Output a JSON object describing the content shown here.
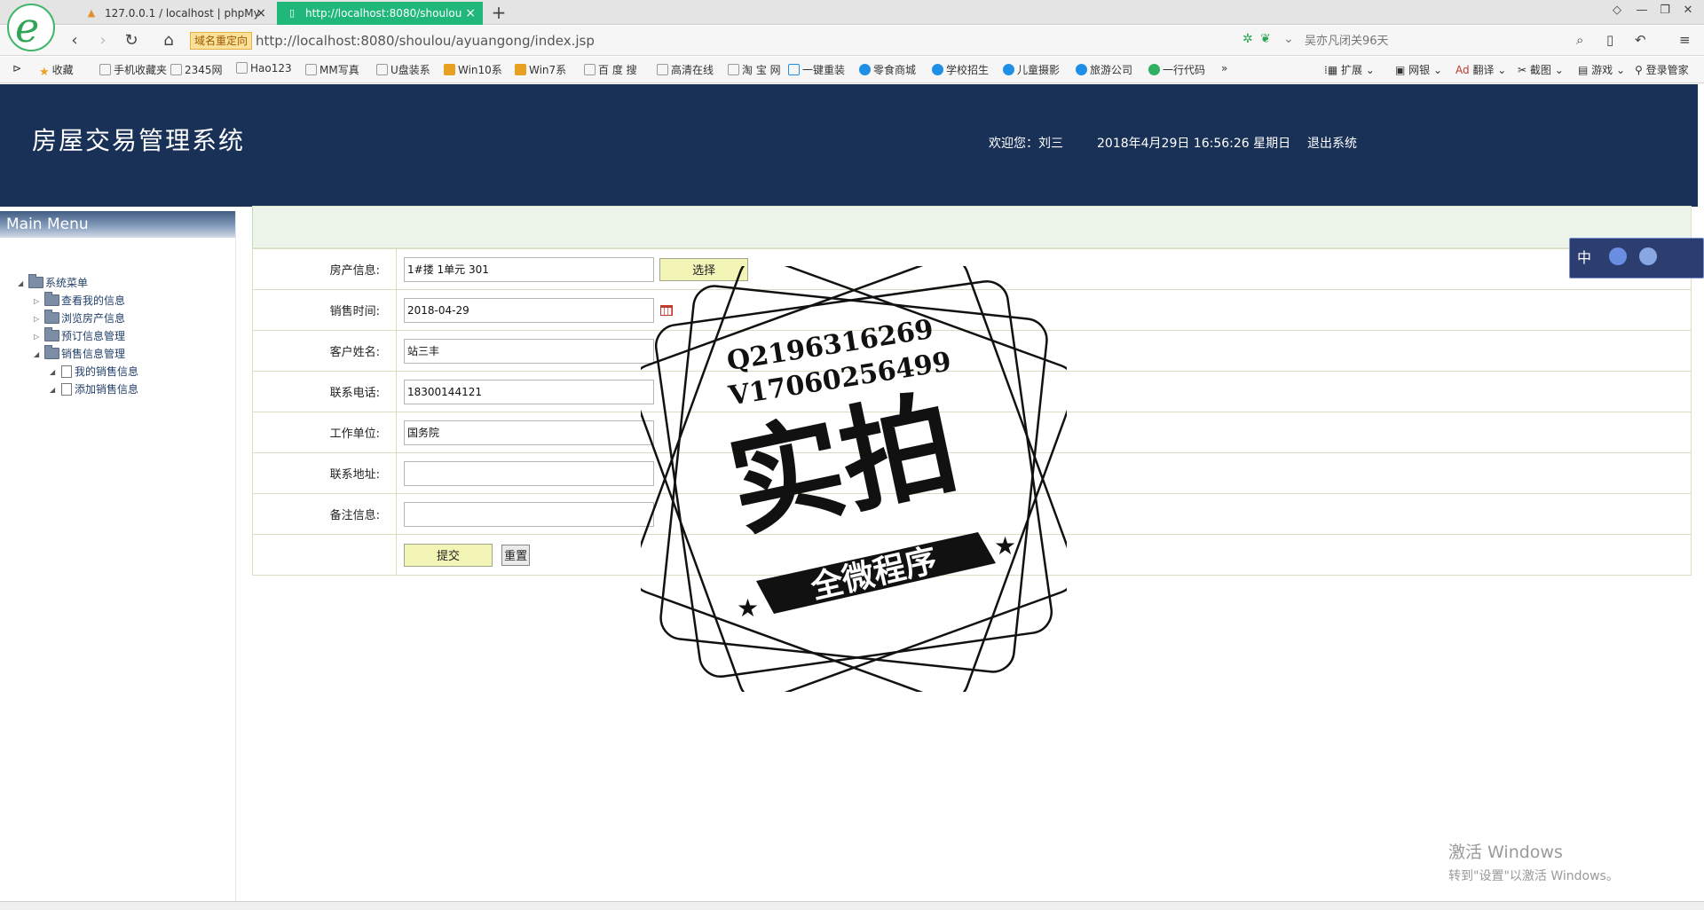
{
  "browser": {
    "tabs": [
      {
        "label": "127.0.0.1 / localhost | phpMy",
        "icon": "phpmyadmin-icon",
        "close": "×"
      },
      {
        "label": "http://localhost:8080/shoulou",
        "icon": "page-icon",
        "close": "×"
      }
    ],
    "new_tab": "+",
    "redirect_badge": "域名重定向",
    "url": "http://localhost:8080/shoulou/ayuangong/index.jsp",
    "search_placeholder": "吴亦凡闭关96天",
    "logo": "e"
  },
  "bookmarks": [
    {
      "label": "收藏",
      "icon": "star"
    },
    {
      "label": "手机收藏夹",
      "icon": "doc"
    },
    {
      "label": "2345网",
      "icon": "doc"
    },
    {
      "label": "Hao123",
      "icon": "doc"
    },
    {
      "label": "MM写真",
      "icon": "doc"
    },
    {
      "label": "U盘装系",
      "icon": "doc"
    },
    {
      "label": "Win10系",
      "icon": "win"
    },
    {
      "label": "Win7系",
      "icon": "win"
    },
    {
      "label": "百 度 搜",
      "icon": "doc"
    },
    {
      "label": "高清在线",
      "icon": "doc"
    },
    {
      "label": "淘 宝 网",
      "icon": "doc"
    },
    {
      "label": "一键重装",
      "icon": "doc"
    },
    {
      "label": "零食商城",
      "icon": "m"
    },
    {
      "label": "学校招生",
      "icon": "m"
    },
    {
      "label": "儿童摄影",
      "icon": "m"
    },
    {
      "label": "旅游公司",
      "icon": "m"
    },
    {
      "label": "一行代码",
      "icon": "g"
    }
  ],
  "bookmarks_more": "»",
  "toolbar_right": [
    {
      "label": "扩展"
    },
    {
      "label": "网银"
    },
    {
      "label": "翻译"
    },
    {
      "label": "截图"
    },
    {
      "label": "游戏"
    },
    {
      "label": "登录管家"
    }
  ],
  "header": {
    "title": "房屋交易管理系统",
    "welcome": "欢迎您：刘三",
    "datetime": "2018年4月29日 16:56:26 星期日",
    "logout": "退出系统"
  },
  "sidebar": {
    "title": "Main Menu",
    "root": "系统菜单",
    "items": [
      {
        "label": "查看我的信息"
      },
      {
        "label": "浏览房产信息"
      },
      {
        "label": "预订信息管理"
      },
      {
        "label": "销售信息管理"
      }
    ],
    "subitems": [
      {
        "label": "我的销售信息"
      },
      {
        "label": "添加销售信息"
      }
    ]
  },
  "form": {
    "property": {
      "label": "房产信息:",
      "value": "1#搂 1单元 301",
      "button": "选择"
    },
    "sale_date": {
      "label": "销售时间:",
      "value": "2018-04-29"
    },
    "customer_name": {
      "label": "客户姓名:",
      "value": "站三丰"
    },
    "phone": {
      "label": "联系电话:",
      "value": "18300144121"
    },
    "work_unit": {
      "label": "工作单位:",
      "value": "国务院"
    },
    "address": {
      "label": "联系地址:",
      "value": ""
    },
    "remarks": {
      "label": "备注信息:",
      "value": ""
    },
    "submit": "提交",
    "reset": "重置"
  },
  "stamp": {
    "line1": "Q2196316269",
    "line2": "V17060256499",
    "main": "实拍",
    "banner": "全微程序"
  },
  "float_widget": {
    "label": "中"
  },
  "windows_activation": {
    "line1": "激活 Windows",
    "line2": "转到\"设置\"以激活 Windows。"
  }
}
